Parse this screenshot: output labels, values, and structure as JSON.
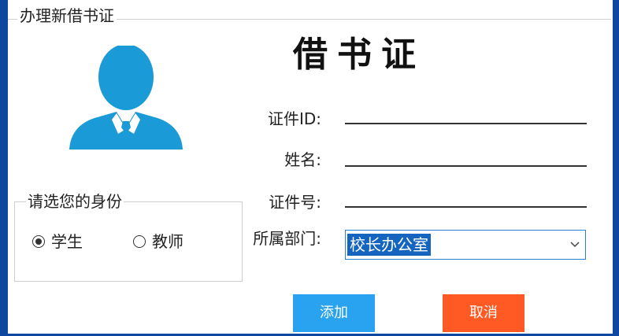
{
  "window": {
    "group_title": "办理新借书证"
  },
  "card": {
    "title": "借书证"
  },
  "form": {
    "id_label": "证件ID:",
    "name_label": "姓名:",
    "number_label": "证件号:",
    "dept_label": "所属部门:",
    "id_value": "",
    "name_value": "",
    "number_value": "",
    "dept_selected": "校长办公室"
  },
  "role": {
    "title": "请选您的身份",
    "options": [
      {
        "label": "学生",
        "checked": true
      },
      {
        "label": "教师",
        "checked": false
      }
    ]
  },
  "buttons": {
    "add": "添加",
    "cancel": "取消"
  },
  "colors": {
    "avatar": "#1a9ad6",
    "add_button": "#29a3f0",
    "cancel_button": "#ff5a24",
    "selection": "#1565c0"
  }
}
